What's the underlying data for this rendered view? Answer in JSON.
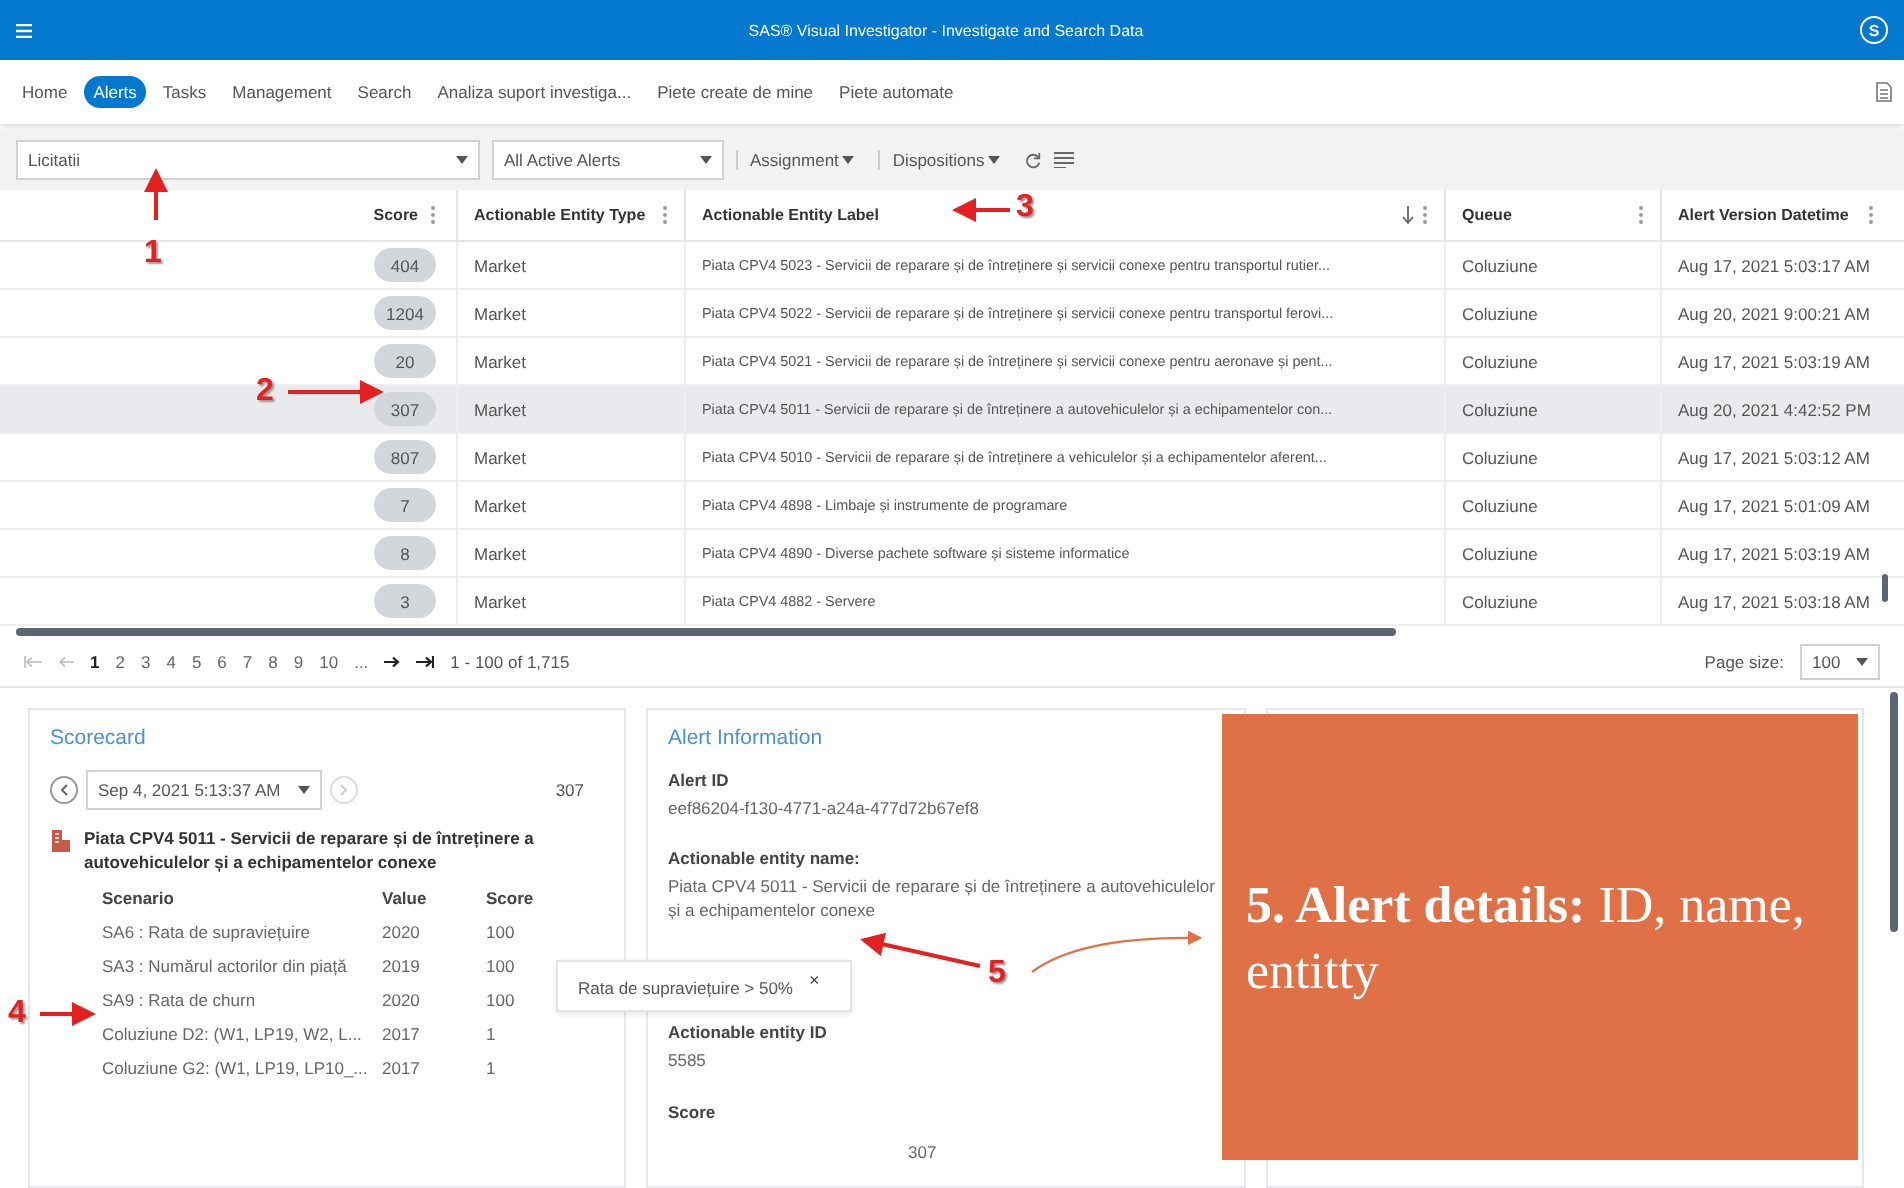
{
  "app_bar": {
    "title": "SAS® Visual Investigator - Investigate and Search Data",
    "avatar": "S"
  },
  "nav_tabs": [
    {
      "label": "Home",
      "selected": false
    },
    {
      "label": "Alerts",
      "selected": true
    },
    {
      "label": "Tasks",
      "selected": false
    },
    {
      "label": "Management",
      "selected": false
    },
    {
      "label": "Search",
      "selected": false
    },
    {
      "label": "Analiza suport investiga...",
      "selected": false
    },
    {
      "label": "Piete create de mine",
      "selected": false
    },
    {
      "label": "Piete automate",
      "selected": false
    }
  ],
  "toolbar": {
    "filter": "Licitatii",
    "view": "All Active Alerts",
    "menus": [
      "Assignment",
      "Dispositions"
    ]
  },
  "table": {
    "columns": [
      {
        "label": "Score",
        "sorted": false
      },
      {
        "label": "Actionable Entity Type",
        "sorted": false
      },
      {
        "label": "Actionable Entity Label",
        "sorted": true
      },
      {
        "label": "Queue",
        "sorted": false
      },
      {
        "label": "Alert Version Datetime",
        "sorted": false
      }
    ],
    "rows": [
      {
        "score": "404",
        "type": "Market",
        "label": "Piata CPV4 5023 - Servicii de reparare și de întreținere și servicii conexe pentru transportul rutier...",
        "queue": "Coluziune",
        "datetime": "Aug 17, 2021 5:03:17 AM",
        "selected": false
      },
      {
        "score": "1204",
        "type": "Market",
        "label": "Piata CPV4 5022 - Servicii de reparare și de întreținere și servicii conexe pentru transportul ferovi...",
        "queue": "Coluziune",
        "datetime": "Aug 20, 2021 9:00:21 AM",
        "selected": false
      },
      {
        "score": "20",
        "type": "Market",
        "label": "Piata CPV4 5021 - Servicii de reparare și de întreținere și servicii conexe pentru aeronave și pent...",
        "queue": "Coluziune",
        "datetime": "Aug 17, 2021 5:03:19 AM",
        "selected": false
      },
      {
        "score": "307",
        "type": "Market",
        "label": "Piata CPV4 5011 - Servicii de reparare și de întreținere a autovehiculelor și a echipamentelor con...",
        "queue": "Coluziune",
        "datetime": "Aug 20, 2021 4:42:52 PM",
        "selected": true
      },
      {
        "score": "807",
        "type": "Market",
        "label": "Piata CPV4 5010 - Servicii de reparare și de întreținere a vehiculelor și a echipamentelor aferent...",
        "queue": "Coluziune",
        "datetime": "Aug 17, 2021 5:03:12 AM",
        "selected": false
      },
      {
        "score": "7",
        "type": "Market",
        "label": "Piata CPV4 4898 - Limbaje și instrumente de programare",
        "queue": "Coluziune",
        "datetime": "Aug 17, 2021 5:01:09 AM",
        "selected": false
      },
      {
        "score": "8",
        "type": "Market",
        "label": "Piata CPV4 4890 - Diverse pachete software și sisteme informatice",
        "queue": "Coluziune",
        "datetime": "Aug 17, 2021 5:03:19 AM",
        "selected": false
      },
      {
        "score": "3",
        "type": "Market",
        "label": "Piata CPV4 4882 - Servere",
        "queue": "Coluziune",
        "datetime": "Aug 17, 2021 5:03:18 AM",
        "selected": false
      }
    ]
  },
  "pagination": {
    "pages": [
      {
        "label": "1",
        "selected": true
      },
      {
        "label": "2",
        "selected": false
      },
      {
        "label": "3",
        "selected": false
      },
      {
        "label": "4",
        "selected": false
      },
      {
        "label": "5",
        "selected": false
      },
      {
        "label": "6",
        "selected": false
      },
      {
        "label": "7",
        "selected": false
      },
      {
        "label": "8",
        "selected": false
      },
      {
        "label": "9",
        "selected": false
      },
      {
        "label": "10",
        "selected": false
      },
      {
        "label": "...",
        "selected": false
      }
    ],
    "range": "1 - 100 of 1,715",
    "page_size_label": "Page size:",
    "page_size": "100"
  },
  "scorecard": {
    "title": "Scorecard",
    "date": "Sep 4, 2021 5:13:37 AM",
    "total": "307",
    "entity": "Piata CPV4 5011 - Servicii de reparare și de întreținere a autovehiculelor și a echipamentelor conexe",
    "columns": [
      "Scenario",
      "Value",
      "Score"
    ],
    "rows": [
      {
        "scenario": "SA6 : Rata de supraviețuire",
        "value": "2020",
        "score": "100"
      },
      {
        "scenario": "SA3 : Numărul actorilor din piață",
        "value": "2019",
        "score": "100"
      },
      {
        "scenario": "SA9 : Rata de churn",
        "value": "2020",
        "score": "100"
      },
      {
        "scenario": "Coluziune D2: (W1, LP19, W2, L...",
        "value": "2017",
        "score": "1"
      },
      {
        "scenario": "Coluziune G2: (W1, LP19, LP10_...",
        "value": "2017",
        "score": "1"
      }
    ]
  },
  "tooltip": {
    "text": "Rata de supraviețuire > 50%",
    "close": "×"
  },
  "alert_info": {
    "title": "Alert Information",
    "fields": [
      {
        "label": "Alert ID",
        "value": "eef86204-f130-4771-a24a-477d72b67ef8"
      },
      {
        "label": "Actionable entity name:",
        "value": "Piata CPV4 5011 - Servicii de reparare și de întreținere a autovehiculelor și a echipamentelor conexe"
      },
      {
        "label": "Actionable entity ID",
        "value": "5585"
      }
    ],
    "score_label": "Score",
    "score": "307"
  },
  "annotations": [
    {
      "label": "1"
    },
    {
      "label": "2"
    },
    {
      "label": "3"
    },
    {
      "label": "4"
    },
    {
      "label": "5"
    }
  ],
  "callout": {
    "text": "**5. Alert details:** ID, name, entitty"
  }
}
